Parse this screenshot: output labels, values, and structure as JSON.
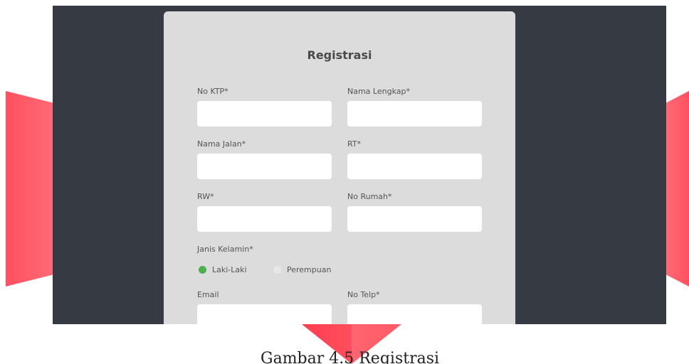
{
  "form": {
    "title": "Registrasi",
    "fields": {
      "no_ktp": {
        "label": "No KTP*",
        "value": ""
      },
      "nama_lengkap": {
        "label": "Nama Lengkap*",
        "value": ""
      },
      "nama_jalan": {
        "label": "Nama Jalan*",
        "value": ""
      },
      "rt": {
        "label": "RT*",
        "value": ""
      },
      "rw": {
        "label": "RW*",
        "value": ""
      },
      "no_rumah": {
        "label": "No Rumah*",
        "value": ""
      },
      "email": {
        "label": "Email",
        "value": ""
      },
      "no_telp": {
        "label": "No Telp*",
        "value": ""
      }
    },
    "gender": {
      "label": "Janis Kelamin*",
      "options": [
        "Laki-Laki",
        "Perempuan"
      ],
      "selected": "Laki-Laki"
    }
  },
  "caption": "Gambar 4.5 Registrasi",
  "colors": {
    "stage_bg": "#363a42",
    "card_bg": "#dcdcdc",
    "ribbon_red": "#ff5a66",
    "radio_selected": "#4caf50"
  }
}
